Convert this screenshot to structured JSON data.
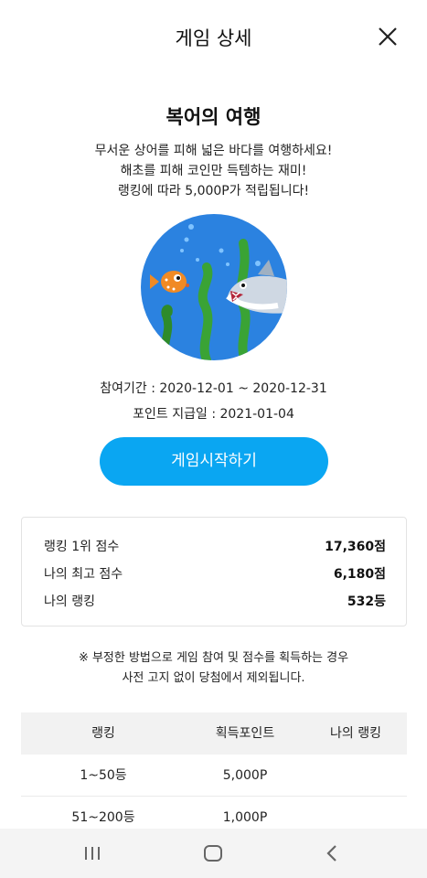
{
  "header": {
    "title": "게임 상세",
    "close_icon": "close-icon"
  },
  "game": {
    "title": "복어의 여행",
    "description": [
      "무서운 상어를 피해 넓은 바다를 여행하세요!",
      "해초를 피해 코인만 득템하는 재미!",
      "랭킹에 따라 5,000P가 적립됩니다!"
    ],
    "period_label": "참여기간 : 2020-12-01 ~ 2020-12-31",
    "paydate_label": "포인트 지급일 : 2021-01-04",
    "start_button": "게임시작하기"
  },
  "scores": [
    {
      "label": "랭킹 1위 점수",
      "value": "17,360점"
    },
    {
      "label": "나의 최고 점수",
      "value": "6,180점"
    },
    {
      "label": "나의 랭킹",
      "value": "532등"
    }
  ],
  "notice": [
    "※ 부정한 방법으로 게임 참여 및 점수를 획득하는 경우",
    "사전 고지 없이 당첨에서 제외됩니다."
  ],
  "ranking_table": {
    "headers": [
      "랭킹",
      "획득포인트",
      "나의 랭킹"
    ],
    "rows": [
      {
        "rank": "1~50등",
        "points": "5,000P",
        "mine": ""
      },
      {
        "rank": "51~200등",
        "points": "1,000P",
        "mine": ""
      }
    ]
  },
  "nav": {
    "recent_icon": "recent-apps-icon",
    "home_icon": "home-icon",
    "back_icon": "back-icon"
  },
  "colors": {
    "accent": "#0aa6f2",
    "ocean": "#2b82e0",
    "seaweed": "#3aa335"
  }
}
